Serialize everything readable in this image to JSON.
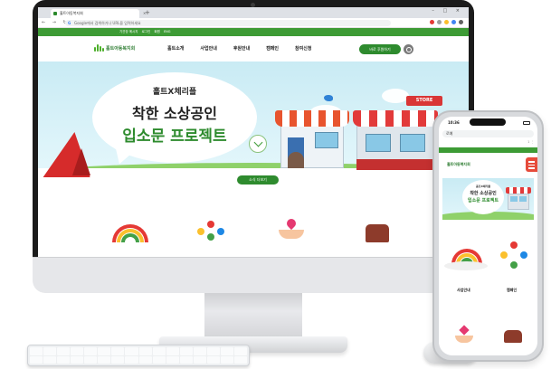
{
  "desktop": {
    "browser": {
      "tab_title": "홀트아동복지회",
      "tab_close": "×",
      "new_tab": "+",
      "window_controls": "– □ ×",
      "nav": "← → ↻",
      "url_text": "Google에서 검색하거나 URL을 입력하세요"
    },
    "site": {
      "top_links": [
        "기관장 메시지",
        "로그인",
        "회원",
        "ENG"
      ],
      "logo_text": "홀트아동복지회",
      "nav": [
        "홀트소개",
        "사업안내",
        "후원안내",
        "캠페인",
        "참여신청"
      ],
      "donate_button": "바로 후원하기",
      "hero": {
        "subtitle": "홀트X체리플",
        "title_line1": "착한 소상공인",
        "title_line2": "입소문 프로젝트",
        "store_sign": "STORE",
        "news_button": "소식 더보기"
      }
    }
  },
  "phone": {
    "time": "10:36",
    "address": "로예",
    "tools": "1 ⋮",
    "logo_text": "홀트아동복지회",
    "hero": {
      "subtitle": "홀트X체리플",
      "title_line1": "착한 소상공인",
      "title_line2": "입소문 프로젝트"
    },
    "quick_links": [
      "사업안내",
      "캠페인"
    ]
  },
  "colors": {
    "brand_green": "#3d9b35",
    "button_green": "#2e8b2e",
    "menu_red": "#e64b3b",
    "sky": "#c9ebf4"
  }
}
